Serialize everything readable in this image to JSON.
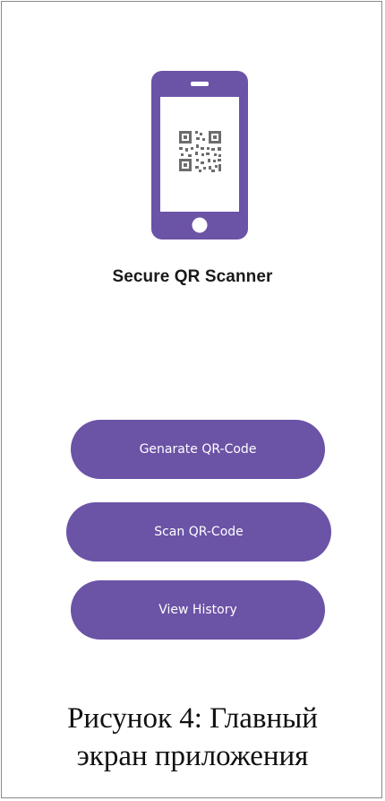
{
  "app": {
    "title": "Secure QR Scanner",
    "icon": "phone-qr-icon"
  },
  "buttons": {
    "generate_label": "Genarate QR-Code",
    "scan_label": "Scan QR-Code",
    "history_label": "View History"
  },
  "caption": {
    "line1": "Рисунок 4: Главный",
    "line2": "экран приложения"
  },
  "colors": {
    "accent": "#6b53a6",
    "background": "#ffffff",
    "title_text": "#1a1a1a",
    "button_text": "#ffffff"
  }
}
